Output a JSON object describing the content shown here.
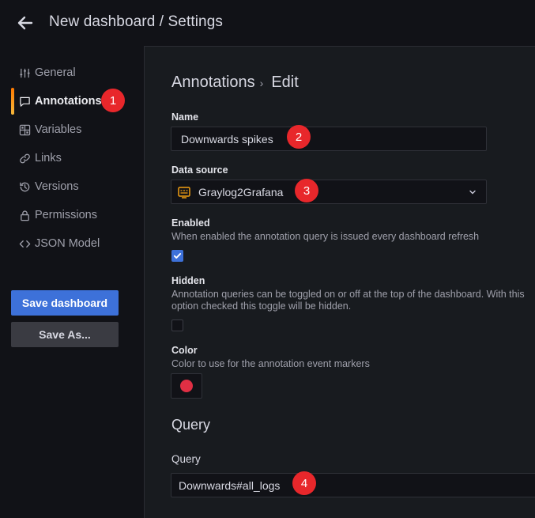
{
  "header": {
    "title": "New dashboard / Settings"
  },
  "sidebar": {
    "items": [
      {
        "label": "General",
        "icon": "sliders-icon"
      },
      {
        "label": "Annotations",
        "icon": "comment-icon",
        "active": true
      },
      {
        "label": "Variables",
        "icon": "variables-icon"
      },
      {
        "label": "Links",
        "icon": "link-icon"
      },
      {
        "label": "Versions",
        "icon": "history-icon"
      },
      {
        "label": "Permissions",
        "icon": "lock-icon"
      },
      {
        "label": "JSON Model",
        "icon": "code-icon"
      }
    ],
    "save_dashboard_label": "Save dashboard",
    "save_as_label": "Save As..."
  },
  "main": {
    "breadcrumb": {
      "parent": "Annotations",
      "current": "Edit"
    },
    "name": {
      "label": "Name",
      "value": "Downwards spikes"
    },
    "datasource": {
      "label": "Data source",
      "value": "Graylog2Grafana"
    },
    "enabled": {
      "label": "Enabled",
      "description": "When enabled the annotation query is issued every dashboard refresh",
      "checked": true
    },
    "hidden": {
      "label": "Hidden",
      "description": "Annotation queries can be toggled on or off at the top of the dashboard. With this option checked this toggle will be hidden.",
      "checked": false
    },
    "color": {
      "label": "Color",
      "description": "Color to use for the annotation event markers",
      "value": "#e02f44"
    },
    "query_section": {
      "title": "Query",
      "query_label": "Query",
      "query_value": "Downwards#all_logs"
    }
  },
  "callouts": [
    "1",
    "2",
    "3",
    "4"
  ],
  "colors": {
    "accent": "#3d71d9",
    "badge": "#e8272b",
    "active_bar": "#ff7a00"
  }
}
